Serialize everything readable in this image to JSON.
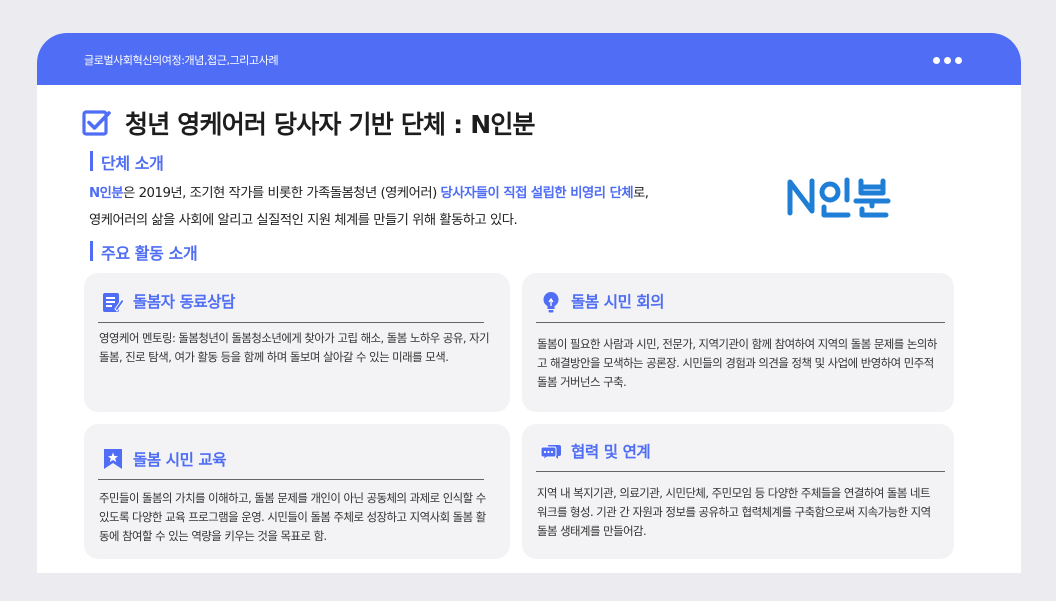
{
  "topbar": {
    "title": "글로벌사회혁신의여정:개념,접근,그리고사례",
    "menu_icon": "more-dots-icon"
  },
  "page": {
    "title": "청년 영케어러 당사자 기반 단체 : N인분",
    "title_icon": "checkbox-icon"
  },
  "intro": {
    "heading": "단체 소개",
    "highlight_name": "N인분",
    "text_1": "은 2019년, 조기현 작가를 비롯한 가족돌봄청년 (영케어러) ",
    "highlight_phrase": "당사자들이 직접 설립한 비영리 단체",
    "text_2": "로,",
    "line_2": "영케어러의 삶을 사회에 알리고 실질적인 지원 체계를 만들기 위해 활동하고 있다.",
    "logo_text": "N인분",
    "accent_color": "#4f6df5"
  },
  "activities": {
    "heading": "주요 활동 소개",
    "items": [
      {
        "title": "돌봄자 동료상담",
        "icon": "memo-icon",
        "text": " 영영케어 멘토링: 돌봄청년이 돌봄청소년에게 찾아가 고립 해소, 돌봄 노하우 공유, 자기돌봄, 진로 탐색, 여가 활동 등을 함께 하며 돌보며 살아갈 수 있는 미래를 모색."
      },
      {
        "title": "돌봄 시민 회의",
        "icon": "lightbulb-icon",
        "text": "돌봄이 필요한 사람과 시민, 전문가, 지역기관이 함께 참여하여 지역의 돌봄 문제를 논의하고 해결방안을 모색하는 공론장. 시민들의 경험과 의견을 정책 및 사업에 반영하여 민주적 돌봄 거버넌스 구축."
      },
      {
        "title": "돌봄 시민 교육",
        "icon": "bookmark-star-icon",
        "text": "주민들이 돌봄의 가치를 이해하고, 돌봄 문제를 개인이 아닌 공동체의 과제로 인식할 수 있도록 다양한 교육 프로그램을 운영. 시민들이 돌봄 주체로 성장하고 지역사회 돌봄 활동에 참여할 수 있는 역량을 키우는 것을 목표로 함."
      },
      {
        "title": "협력 및 연계",
        "icon": "chat-bubbles-icon",
        "text": "지역 내 복지기관, 의료기관, 시민단체, 주민모임 등 다양한 주체들을 연결하여 돌봄 네트워크를 형성. 기관 간 자원과 정보를 공유하고 협력체계를 구축함으로써 지속가능한 지역 돌봄 생태계를 만들어감."
      }
    ]
  }
}
